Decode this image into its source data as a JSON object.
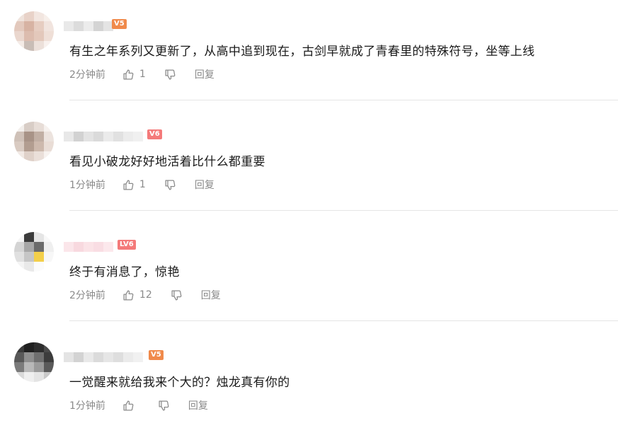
{
  "comments": [
    {
      "content": "有生之年系列又更新了，从高中追到现在，古剑早就成了青春里的特殊符号，坐等上线",
      "time": "2分钟前",
      "likes": "1",
      "level": "V5",
      "reply_label": "回复",
      "level_color": "#f08a4b"
    },
    {
      "content": "看见小破龙好好地活着比什么都重要",
      "time": "1分钟前",
      "likes": "1",
      "level": "V6",
      "reply_label": "回复",
      "level_color": "#f47a7a"
    },
    {
      "content": "终于有消息了，惊艳",
      "time": "2分钟前",
      "likes": "12",
      "level": "LV6",
      "reply_label": "回复",
      "level_color": "#f47a7a"
    },
    {
      "content": "一觉醒来就给我来个大的？烛龙真有你的",
      "time": "1分钟前",
      "likes": "",
      "level": "V5",
      "reply_label": "回复",
      "level_color": "#f08a4b"
    }
  ],
  "colors": {
    "text": "#1a1a1a",
    "meta": "#8a8a8a",
    "divider": "#e5e5e5"
  },
  "icons": {
    "like": "thumbs-up-icon",
    "dislike": "thumbs-down-icon"
  }
}
